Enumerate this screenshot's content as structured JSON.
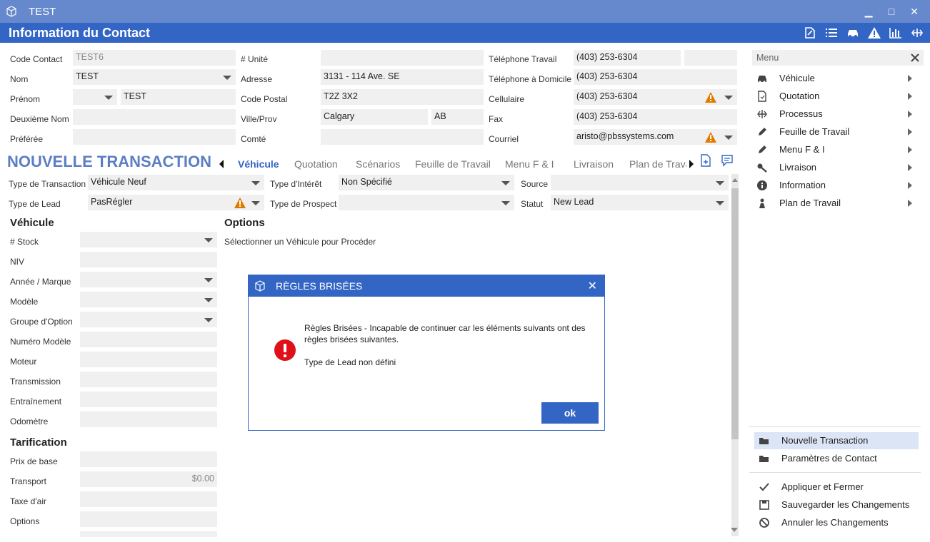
{
  "window": {
    "title": "TEST",
    "minimize": "▁",
    "maximize": "□",
    "close": "✕"
  },
  "header": {
    "title": "Information du Contact"
  },
  "contact": {
    "code_label": "Code Contact",
    "code_value": "TEST6",
    "nom_label": "Nom",
    "nom_value": "TEST",
    "prenom_label": "Prénom",
    "prenom_value": "TEST",
    "deuxieme_nom_label": "Deuxième Nom",
    "preferee_label": "Préférée",
    "unite_label": "# Unité",
    "adresse_label": "Adresse",
    "adresse_value": "3131 - 114 Ave. SE",
    "code_postal_label": "Code Postal",
    "code_postal_value": "T2Z 3X2",
    "ville_label": "Ville/Prov",
    "ville_value": "Calgary",
    "prov_value": "AB",
    "comte_label": "Comté",
    "tel_travail_label": "Téléphone Travail",
    "tel_travail_value": "(403) 253-6304",
    "tel_domicile_label": "Téléphone à Domicile",
    "tel_domicile_value": "(403) 253-6304",
    "cellulaire_label": "Cellulaire",
    "cellulaire_value": "(403) 253-6304",
    "fax_label": "Fax",
    "fax_value": "(403) 253-6304",
    "courriel_label": "Courriel",
    "courriel_value": "aristo@pbssystems.com"
  },
  "transaction": {
    "title": "NOUVELLE TRANSACTION",
    "tabs": [
      "Véhicule",
      "Quotation",
      "Scénarios",
      "Feuille de Travail",
      "Menu F & I",
      "Livraison",
      "Plan de Trava"
    ],
    "type_transaction_label": "Type de Transaction",
    "type_transaction_value": "Véhicule Neuf",
    "type_lead_label": "Type de Lead",
    "type_lead_value": "PasRégler",
    "type_interet_label": "Type d'Intérêt",
    "type_interet_value": "Non Spécifié",
    "type_prospect_label": "Type de Prospect",
    "source_label": "Source",
    "statut_label": "Statut",
    "statut_value": "New Lead"
  },
  "vehicule": {
    "heading": "Véhicule",
    "stock_label": "# Stock",
    "niv_label": "NIV",
    "annee_label": "Année / Marque",
    "modele_label": "Modèle",
    "groupe_label": "Groupe d'Option",
    "numero_modele_label": "Numéro Modèle",
    "moteur_label": "Moteur",
    "transmission_label": "Transmission",
    "entrainement_label": "Entraînement",
    "odometre_label": "Odomètre"
  },
  "tarification": {
    "heading": "Tarification",
    "prix_label": "Prix de base",
    "transport_label": "Transport",
    "transport_value": "$0.00",
    "taxe_label": "Taxe d'air",
    "options_label": "Options"
  },
  "options": {
    "heading": "Options",
    "hint": "Sélectionner un Véhicule pour Procéder"
  },
  "menu": {
    "placeholder": "Menu",
    "items": [
      "Véhicule",
      "Quotation",
      "Processus",
      "Feuille de Travail",
      "Menu F & I",
      "Livraison",
      "Information",
      "Plan de Travail"
    ],
    "actions": [
      "Nouvelle Transaction",
      "Paramètres de Contact"
    ],
    "commands": [
      "Appliquer et Fermer",
      "Sauvegarder les Changements",
      "Annuler les Changements"
    ]
  },
  "dialog": {
    "title": "RÈGLES BRISÉES",
    "line1": "Règles Brisées - Incapable de continuer car les éléments suivants ont des",
    "line2": "règles brisées suivantes.",
    "line3": "Type de Lead non défini",
    "ok_label": "ok"
  },
  "colors": {
    "accent": "#3366c4",
    "titlebar": "#6688cc",
    "warning": "#e07b00",
    "error": "#e0101a"
  }
}
